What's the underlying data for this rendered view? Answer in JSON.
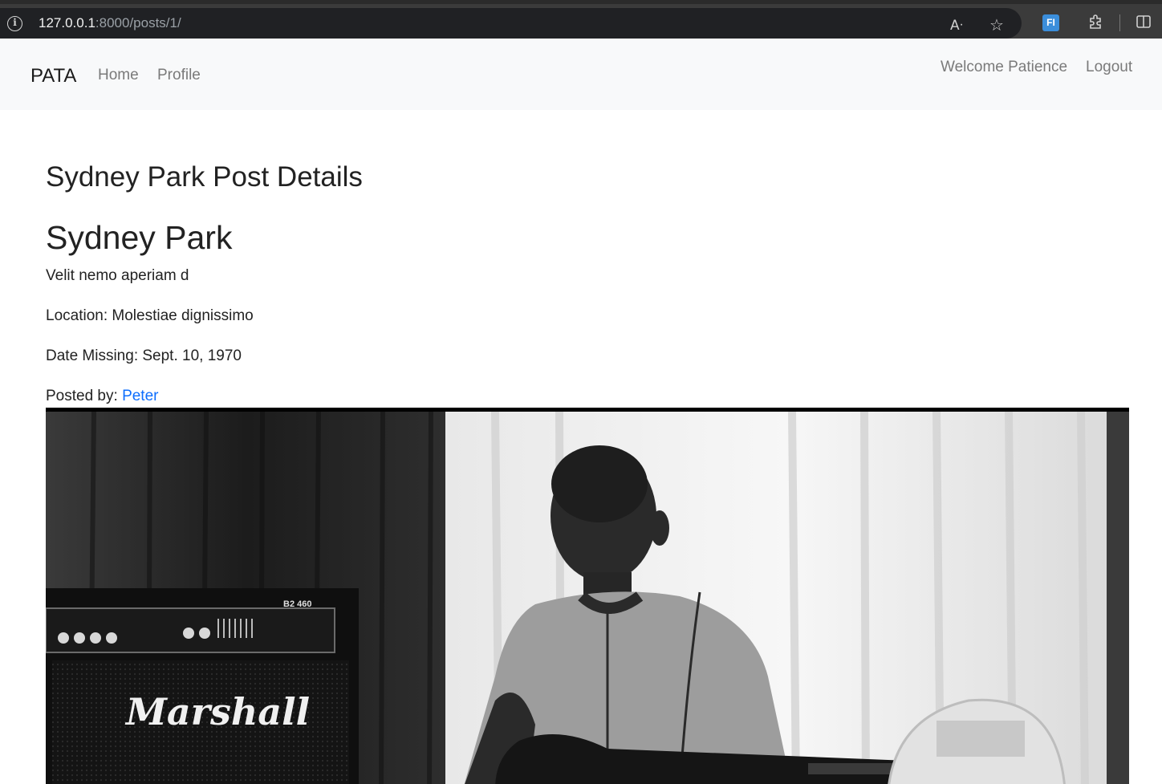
{
  "browser": {
    "url_host": "127.0.0.1",
    "url_path": ":8000/posts/1/",
    "extension_label": "FI"
  },
  "navbar": {
    "brand": "PATA",
    "links": [
      "Home",
      "Profile"
    ],
    "welcome": "Welcome Patience",
    "logout": "Logout"
  },
  "post": {
    "page_title": "Sydney Park Post Details",
    "name": "Sydney Park",
    "description": "Velit nemo aperiam d",
    "location": "Location: Molestiae dignissimo",
    "date_missing": "Date Missing: Sept. 10, 1970",
    "posted_by_label": "Posted by:",
    "posted_by_user": "Peter",
    "photo_amp_brand": "Marshall",
    "photo_amp_model": "B2 460"
  },
  "colors": {
    "link": "#0d6efd",
    "navbar_bg": "#f8f9fa",
    "chrome_bg": "#3b3b3b"
  }
}
